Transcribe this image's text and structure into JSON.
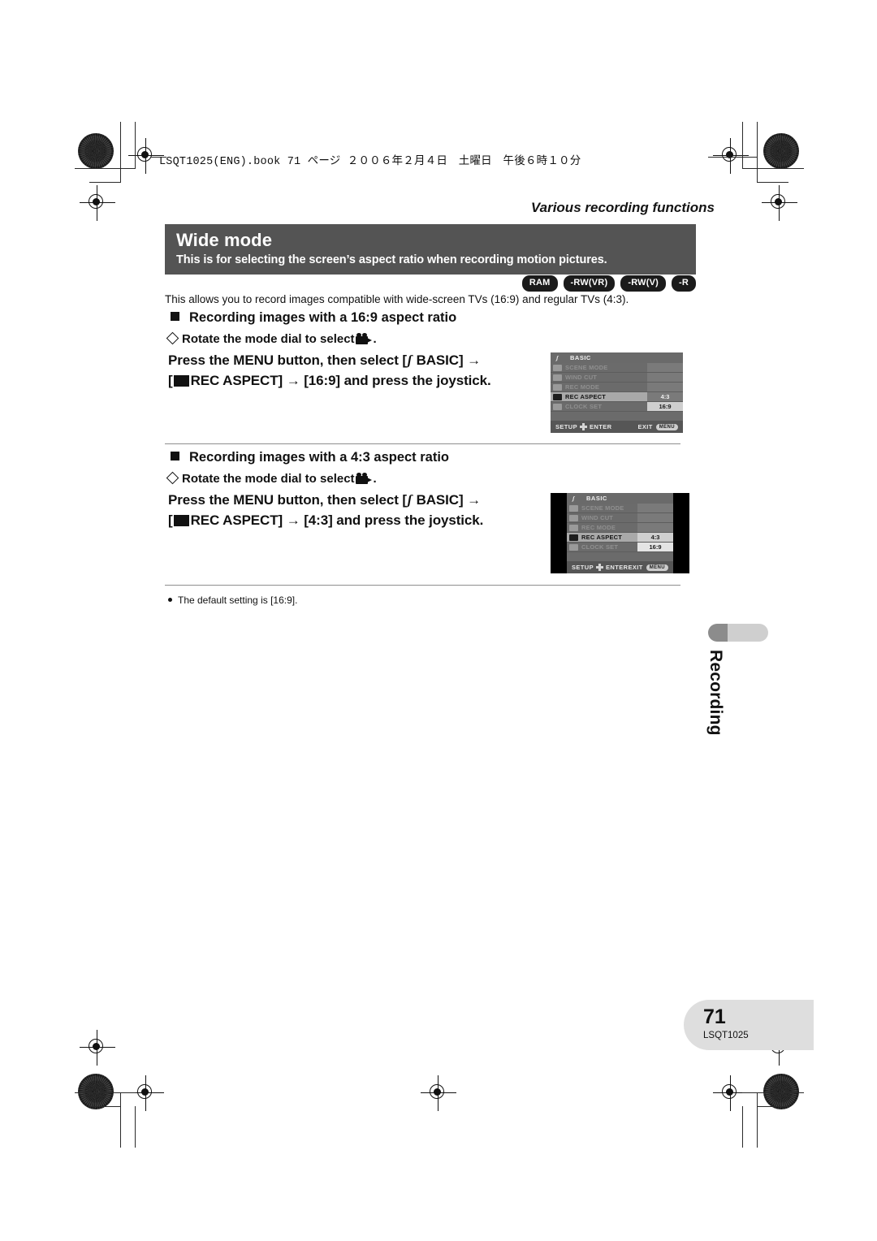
{
  "header": {
    "book_line": "LSQT1025(ENG).book  71 ページ  ２００６年２月４日　土曜日　午後６時１０分",
    "section_kicker": "Various recording functions"
  },
  "title_band": {
    "title": "Wide mode",
    "subtitle": "This is for selecting the screen’s aspect ratio when recording motion pictures."
  },
  "media_badges": [
    "RAM",
    "-RW(VR)",
    "-RW(V)",
    "-R"
  ],
  "intro": "This allows you to record images compatible with wide-screen TVs (16:9) and regular TVs (4:3).",
  "sections": [
    {
      "heading": "Recording images with a 16:9 aspect ratio",
      "dial_step": "Rotate the mode dial to select",
      "press_line1_a": "Press the MENU button, then select [",
      "press_line1_b": "BASIC]",
      "press_line1_arrow": "→",
      "press_line2_a": "REC ASPECT]",
      "press_line2_arrow": "→",
      "press_line2_b": "[16:9] and press the joystick."
    },
    {
      "heading": "Recording images with a 4:3 aspect ratio",
      "dial_step": "Rotate the mode dial to select",
      "press_line1_a": "Press the MENU button, then select [",
      "press_line1_b": "BASIC]",
      "press_line1_arrow": "→",
      "press_line2_a": "REC ASPECT]",
      "press_line2_arrow": "→",
      "press_line2_b": "[4:3] and press the joystick."
    }
  ],
  "lcd_1": {
    "title": "BASIC",
    "rows": [
      {
        "label": "SCENE MODE",
        "value": ""
      },
      {
        "label": "WIND CUT",
        "value": ""
      },
      {
        "label": "REC MODE",
        "value": ""
      },
      {
        "label": "REC ASPECT",
        "value": "4:3"
      },
      {
        "label": "CLOCK SET",
        "value": "16:9"
      }
    ],
    "selected_row": 3,
    "highlighted_value_row": 4,
    "bottom_left": "SETUP",
    "bottom_enter": "ENTER",
    "bottom_exit": "EXIT",
    "bottom_exit_pill": "MENU"
  },
  "lcd_2": {
    "title": "BASIC",
    "rows": [
      {
        "label": "SCENE MODE",
        "value": ""
      },
      {
        "label": "WIND CUT",
        "value": ""
      },
      {
        "label": "REC MODE",
        "value": ""
      },
      {
        "label": "REC ASPECT",
        "value": "4:3"
      },
      {
        "label": "CLOCK SET",
        "value": "16:9"
      }
    ],
    "selected_row": 3,
    "highlighted_value_row": 3,
    "bottom_left": "SETUP",
    "bottom_enter": "ENTER",
    "bottom_exit": "EXIT",
    "bottom_exit_pill": "MENU"
  },
  "note": "The default setting is [16:9].",
  "side_tab": "Recording",
  "footer": {
    "page_number": "71",
    "doc_code": "LSQT1025"
  }
}
